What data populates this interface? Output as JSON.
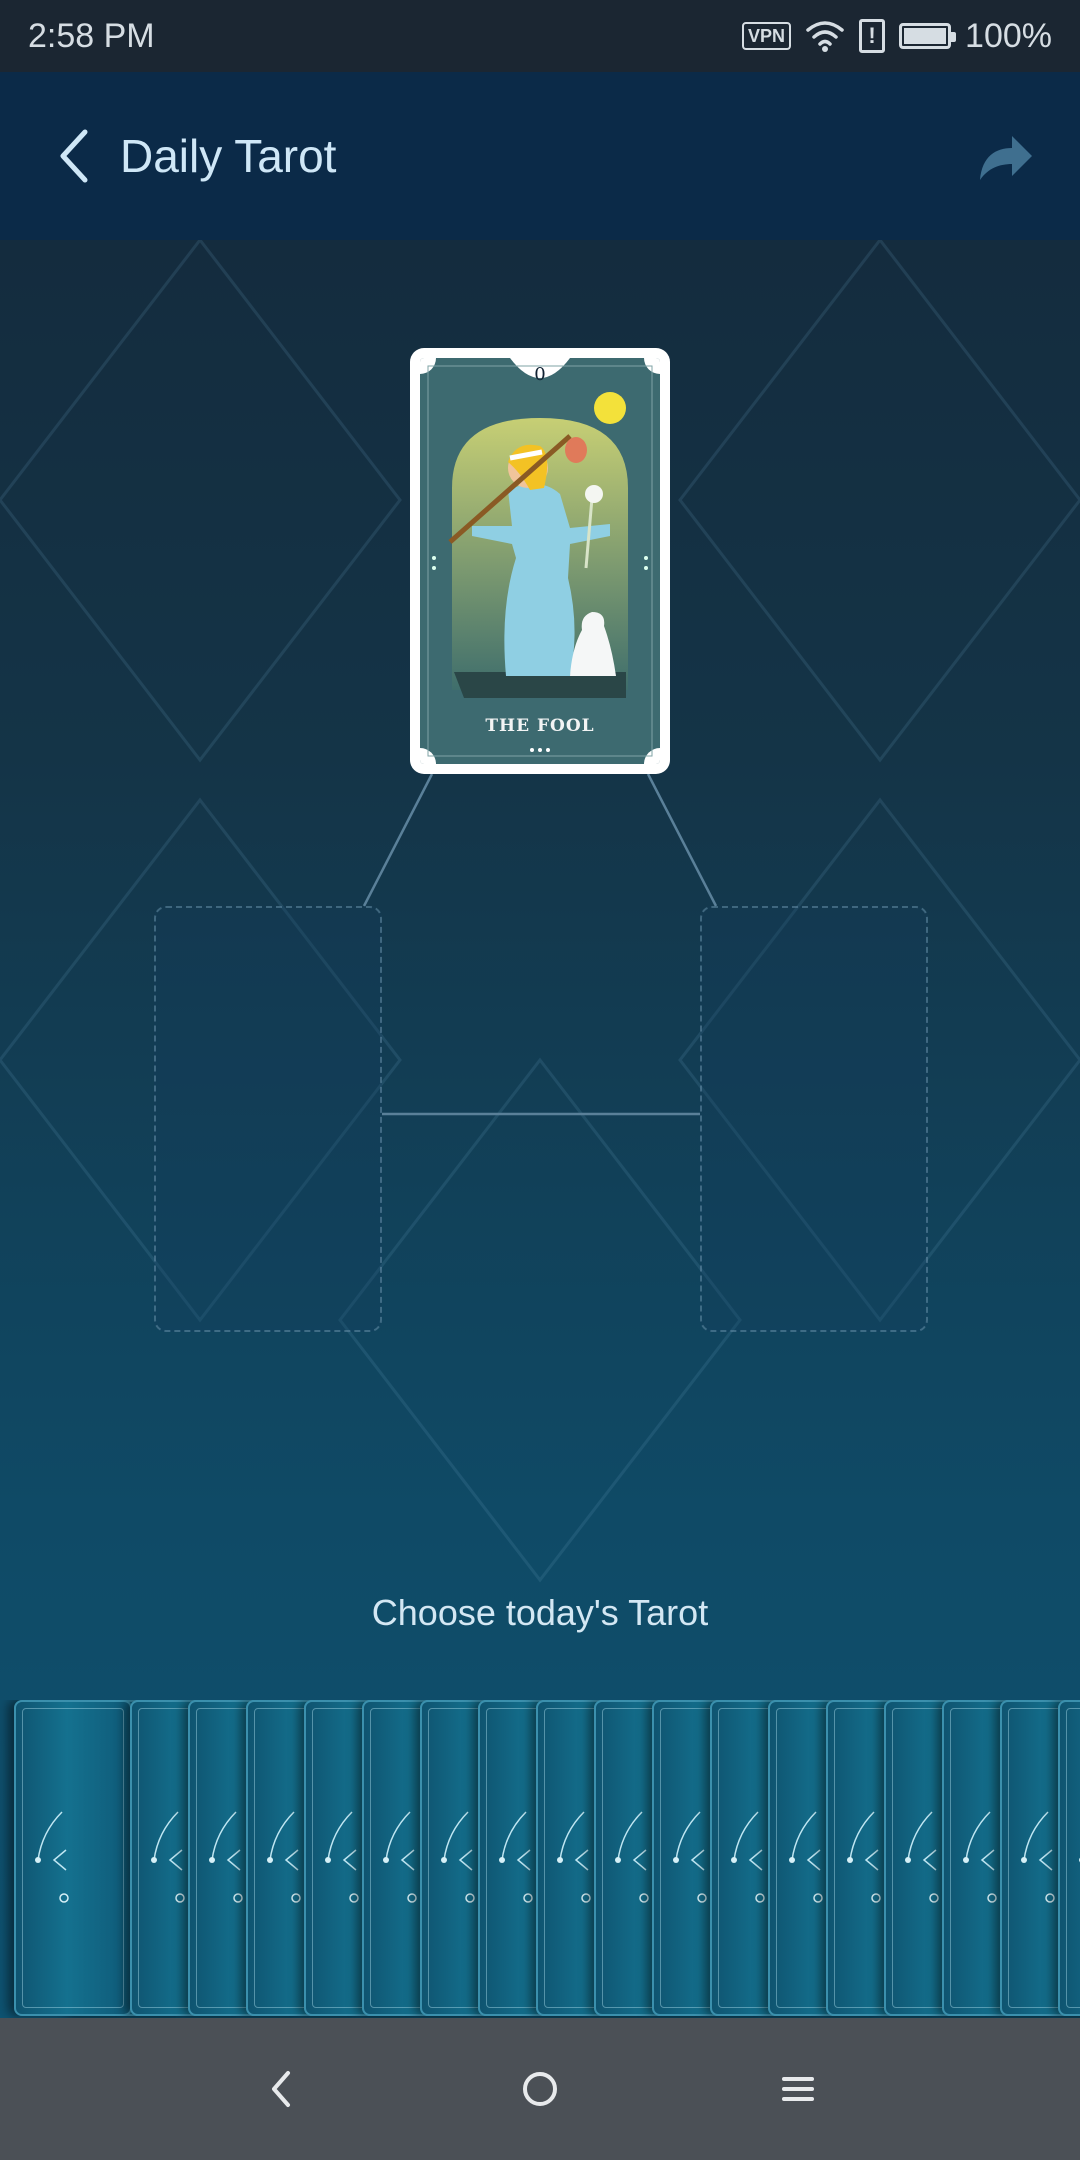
{
  "status_bar": {
    "time": "2:58 PM",
    "vpn_label": "VPN",
    "alert_glyph": "!",
    "battery": "100%"
  },
  "app_bar": {
    "title": "Daily Tarot",
    "back_icon": "chevron-left-icon",
    "share_icon": "share-arrow-icon"
  },
  "selected_card": {
    "number": "0",
    "name": "THE FOOL"
  },
  "prompt": "Choose today's Tarot",
  "deck": {
    "card_count": 19,
    "card_back_icon": "sun-moon-card-back"
  },
  "nav_bar": {
    "back": "nav-back-icon",
    "home": "nav-home-icon",
    "menu": "nav-menu-icon"
  },
  "colors": {
    "app_bar": "#0b2a48",
    "status_bar": "#1b2632",
    "background_top": "#14283a",
    "background_bottom": "#0e5574",
    "deck_card": "#14718f",
    "nav_bar": "#4b5056"
  }
}
